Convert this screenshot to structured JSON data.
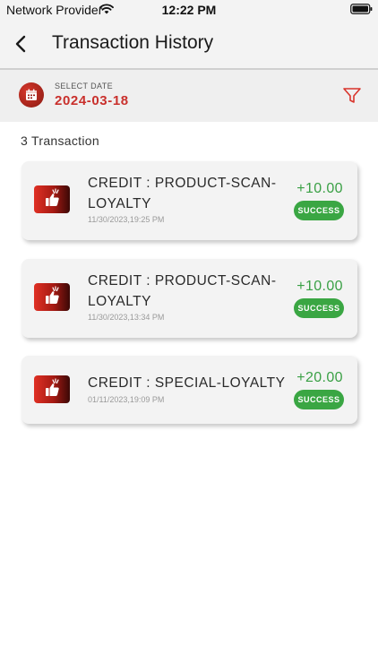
{
  "status_bar": {
    "provider": "Network Provider",
    "time": "12:22 PM"
  },
  "header": {
    "title": "Transaction History",
    "back_icon": "chevron-left-icon"
  },
  "date_filter": {
    "label": "SELECT DATE",
    "value": "2024-03-18",
    "icon": "calendar-icon",
    "filter_icon": "filter-icon"
  },
  "summary": {
    "count_text": "3 Transaction"
  },
  "colors": {
    "accent_red": "#c9302c",
    "success_green": "#3aa643",
    "amount_green": "#3aa045"
  },
  "transactions": [
    {
      "title": "CREDIT : PRODUCT-SCAN-LOYALTY",
      "date": "11/30/2023,19:25 PM",
      "amount": "+10.00",
      "status": "SUCCESS",
      "icon": "thumbs-up-icon"
    },
    {
      "title": "CREDIT : PRODUCT-SCAN-LOYALTY",
      "date": "11/30/2023,13:34 PM",
      "amount": "+10.00",
      "status": "SUCCESS",
      "icon": "thumbs-up-icon"
    },
    {
      "title": "CREDIT : SPECIAL-LOYALTY",
      "date": "01/11/2023,19:09 PM",
      "amount": "+20.00",
      "status": "SUCCESS",
      "icon": "thumbs-up-icon"
    }
  ]
}
